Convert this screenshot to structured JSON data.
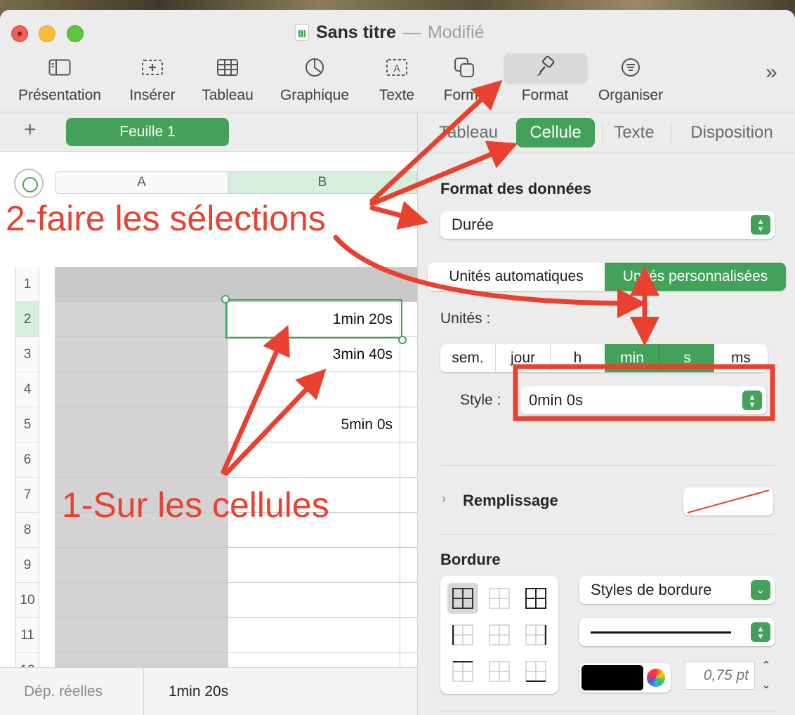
{
  "window": {
    "title": "Sans titre",
    "separator": "—",
    "status": "Modifié"
  },
  "toolbar": {
    "items": [
      {
        "label": "Présentation",
        "icon": "sidebar-icon"
      },
      {
        "label": "Insérer",
        "icon": "insert-icon"
      },
      {
        "label": "Tableau",
        "icon": "table-icon"
      },
      {
        "label": "Graphique",
        "icon": "chart-icon"
      },
      {
        "label": "Texte",
        "icon": "text-icon"
      },
      {
        "label": "Forme",
        "icon": "shape-icon"
      },
      {
        "label": "Format",
        "icon": "paintbrush-icon"
      },
      {
        "label": "Organiser",
        "icon": "organize-icon"
      }
    ],
    "more": "»"
  },
  "sheetbar": {
    "add": "+",
    "sheet_tab": "Feuille 1"
  },
  "sheet": {
    "columns": [
      "A",
      "B"
    ],
    "rows": [
      "1",
      "2",
      "3",
      "4",
      "5",
      "6",
      "7",
      "8",
      "9",
      "10",
      "11",
      "12"
    ],
    "cells_b": [
      "",
      "1min 20s",
      "3min 40s",
      "",
      "5min 0s",
      "",
      "",
      "",
      "",
      "",
      "",
      ""
    ]
  },
  "statusbar": {
    "label": "Dép. réelles",
    "value": "1min 20s"
  },
  "inspector": {
    "tabs": [
      "Tableau",
      "Cellule",
      "Texte",
      "Disposition"
    ],
    "active_tab": "Cellule",
    "data_format_heading": "Format des données",
    "data_format_value": "Durée",
    "units_mode": [
      "Unités automatiques",
      "Unités personnalisées"
    ],
    "units_label": "Unités :",
    "units": [
      "sem.",
      "jour",
      "h",
      "min",
      "s",
      "ms"
    ],
    "style_label": "Style :",
    "style_value": "0min 0s",
    "fill_label": "Remplissage",
    "border_heading": "Bordure",
    "border_styles": "Styles de bordure",
    "border_width": "0,75 pt"
  },
  "annotations": {
    "step1": "1-Sur les cellules",
    "step2": "2-faire les sélections"
  },
  "colors": {
    "accent": "#43a159",
    "annotation": "#e8412f"
  }
}
